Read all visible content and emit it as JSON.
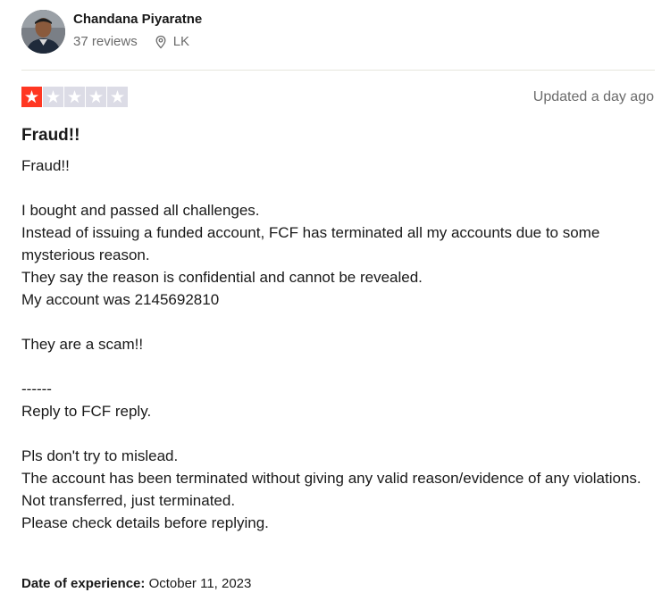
{
  "reviewer": {
    "name": "Chandana Piyaratne",
    "review_count": "37 reviews",
    "location": "LK"
  },
  "rating": {
    "stars": 1,
    "max": 5,
    "star_on_color": "#ff3722",
    "star_off_color": "#dcdce6"
  },
  "updated": "Updated a day ago",
  "review": {
    "title": "Fraud!!",
    "lines": [
      "Fraud!!",
      "",
      "I bought and passed all challenges.",
      "Instead of issuing a funded account, FCF has terminated all my accounts due to some mysterious reason.",
      "They say the reason is confidential and cannot be revealed.",
      "My account was 2145692810",
      "",
      "They are a scam!!",
      "",
      "------",
      "Reply to FCF reply.",
      "",
      "Pls don't try to mislead.",
      "The account has been terminated without giving any valid reason/evidence of any violations.",
      "Not transferred, just terminated.",
      "Please check details before replying."
    ]
  },
  "experience": {
    "label": "Date of experience:",
    "date": "October 11, 2023"
  },
  "icons": {
    "location": "location-pin-icon",
    "star": "star-icon"
  }
}
